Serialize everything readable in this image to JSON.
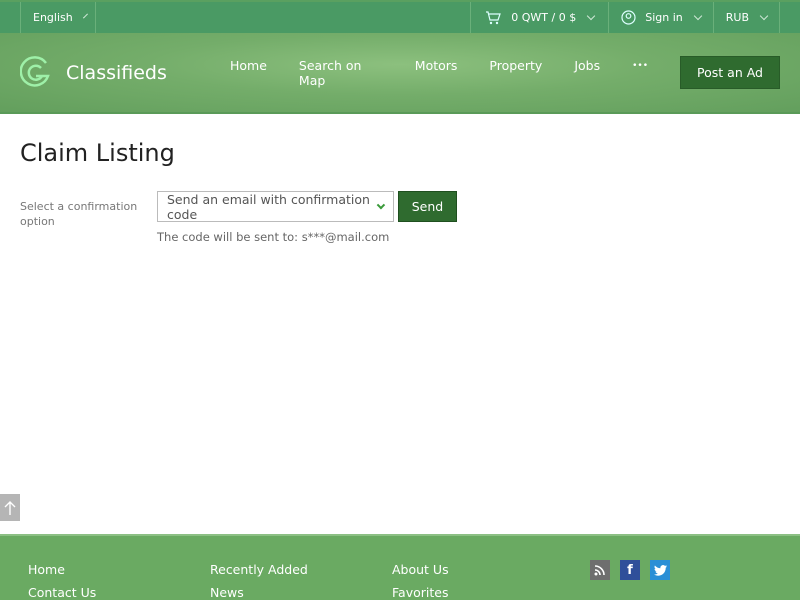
{
  "topbar": {
    "language": "English",
    "cart": "0 QWT / 0 $",
    "signin": "Sign in",
    "currency": "RUB"
  },
  "header": {
    "brand": "Classifieds",
    "nav": [
      "Home",
      "Search on Map",
      "Motors",
      "Property",
      "Jobs"
    ],
    "more": "•••",
    "post_ad": "Post an Ad"
  },
  "main": {
    "title": "Claim Listing",
    "option_label": "Select a confirmation option",
    "select_value": "Send an email with confirmation code",
    "send": "Send",
    "hint": "The code will be sent to: s***@mail.com"
  },
  "footer": {
    "col1": [
      "Home",
      "Contact Us"
    ],
    "col2": [
      "Recently Added",
      "News"
    ],
    "col3": [
      "About Us",
      "Favorites"
    ],
    "social": [
      "rss-icon",
      "facebook-icon",
      "twitter-icon"
    ]
  },
  "colors": {
    "accent": "#2f6b2f",
    "topbar": "#4a9a64",
    "footer": "#6aaa62"
  }
}
